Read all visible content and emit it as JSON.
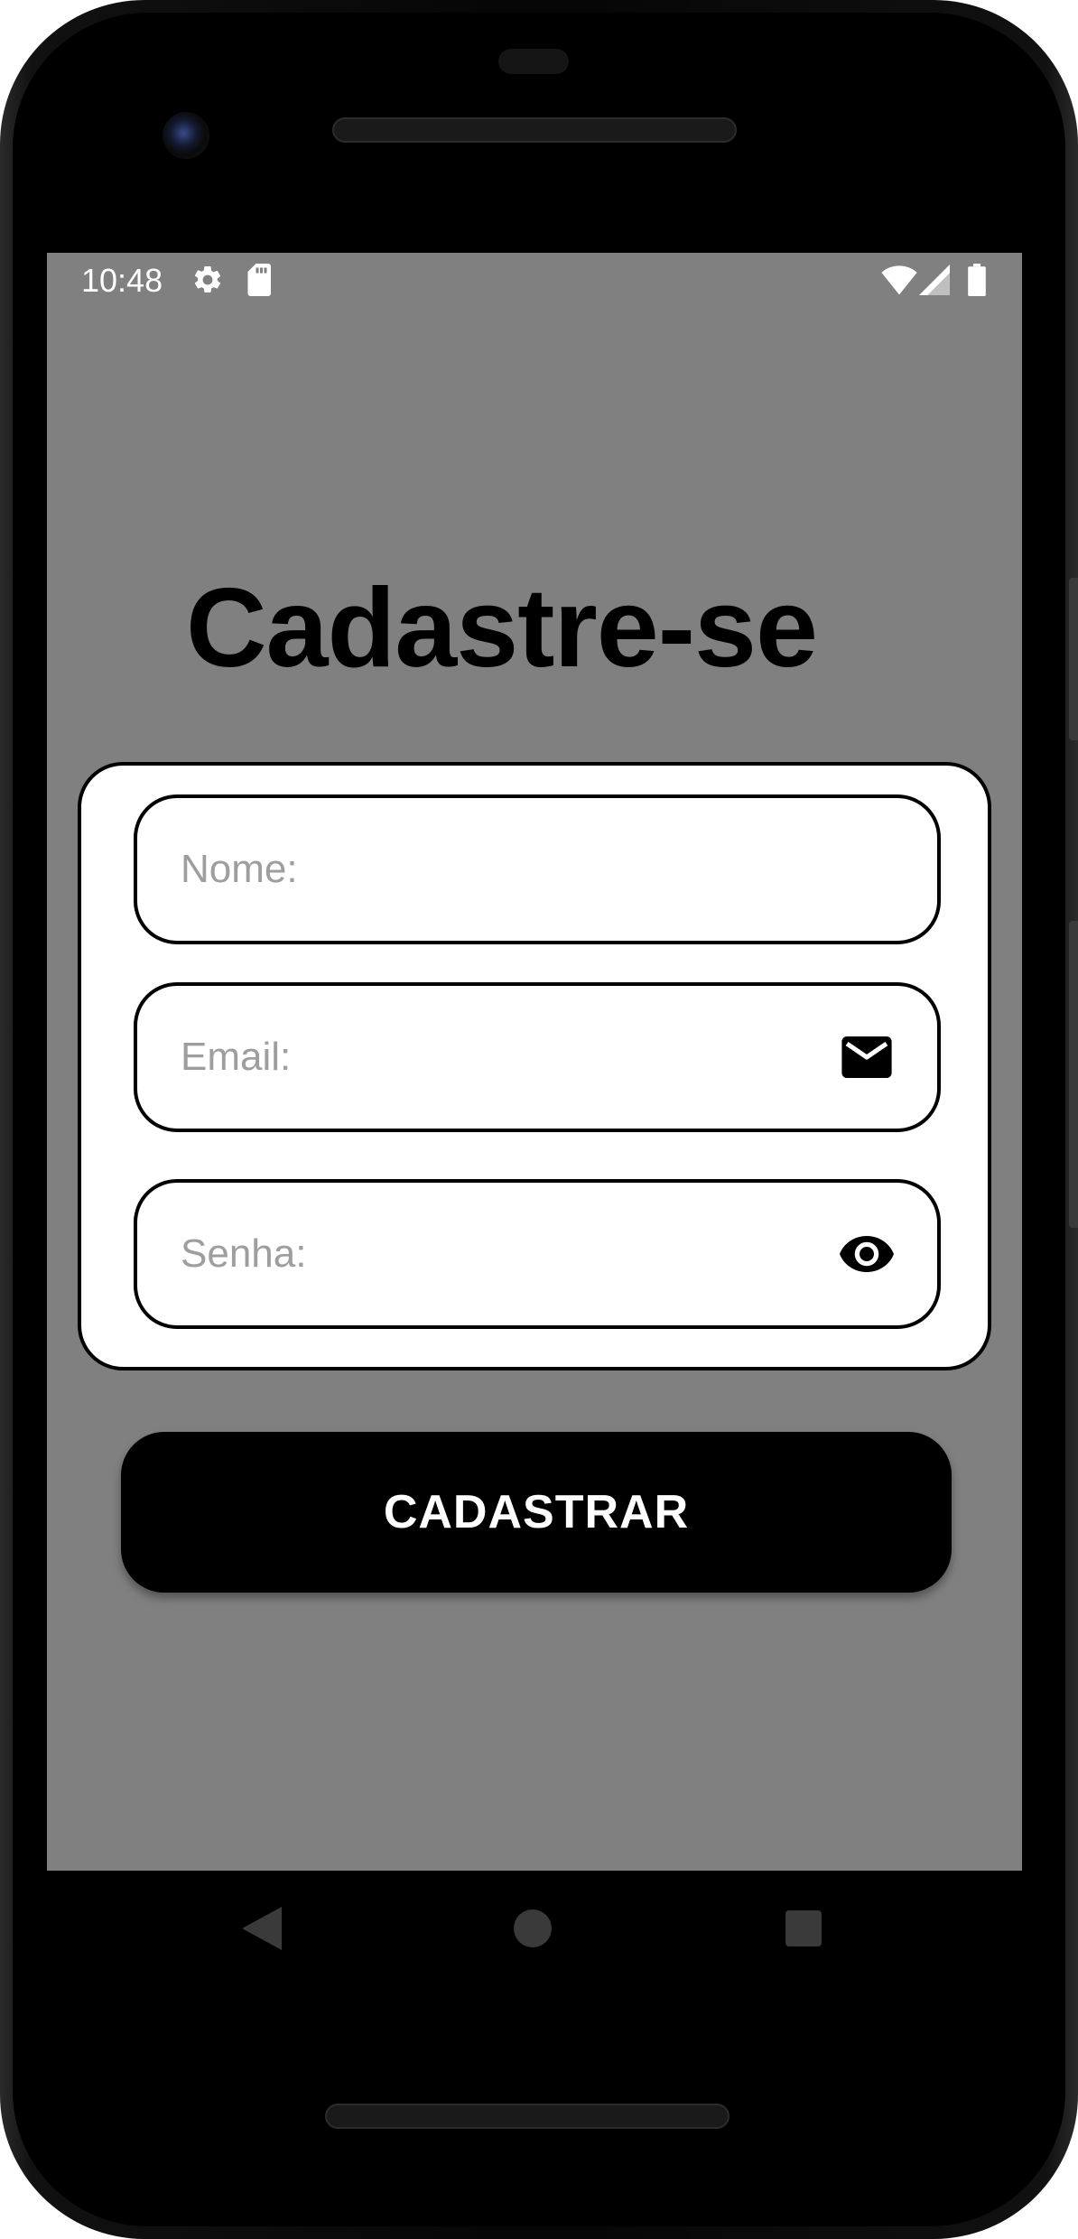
{
  "status_bar": {
    "time": "10:48",
    "icons": [
      "gear-icon",
      "sd-card-icon",
      "wifi-icon",
      "signal-icon",
      "battery-icon"
    ]
  },
  "page": {
    "title": "Cadastre-se"
  },
  "form": {
    "name_field": {
      "placeholder": "Nome:",
      "value": ""
    },
    "email_field": {
      "placeholder": "Email:",
      "value": "",
      "icon": "mail-icon"
    },
    "password_field": {
      "placeholder": "Senha:",
      "value": "",
      "icon": "eye-icon"
    },
    "submit_label": "CADASTRAR"
  },
  "navigation": {
    "buttons": [
      "back-icon",
      "home-icon",
      "recents-icon"
    ]
  },
  "colors": {
    "screen_background": "#808080",
    "card_background": "#ffffff",
    "accent": "#000000",
    "placeholder": "#9e9e9e"
  }
}
